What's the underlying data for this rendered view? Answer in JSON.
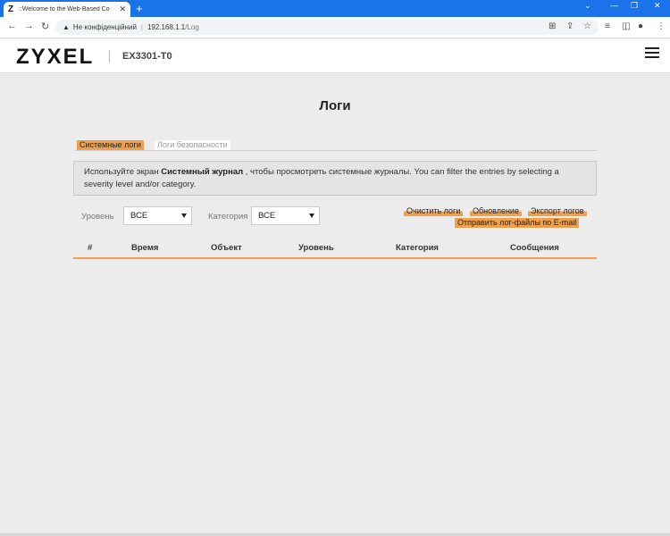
{
  "browser": {
    "tab_title": "::Welcome to the Web-Based Co",
    "tab_favicon": "Z",
    "security_label": "Не конфіденційний",
    "url": "192.168.1.1",
    "url_path": "/Log"
  },
  "header": {
    "logo": "ZYXEL",
    "model": "EX3301-T0"
  },
  "page": {
    "title": "Логи"
  },
  "tabs": {
    "system": "Системные логи",
    "security": "Логи безопасности"
  },
  "info": {
    "part1": "Используйте экран ",
    "bold": "Системный журнал",
    "part2": " , чтобы просмотреть системные журналы. You can filter the entries by selecting a severity level and/or category."
  },
  "filters": {
    "level_label": "Уровень",
    "level_value": "ВСЕ",
    "category_label": "Категория",
    "category_value": "ВСЕ"
  },
  "actions": {
    "clear": "Очистить логи",
    "refresh": "Обновление",
    "export": "Экспорт логов",
    "email": "Отправить лог-файлы по E-mail"
  },
  "table": {
    "columns": [
      "#",
      "Время",
      "Объект",
      "Уровень",
      "Категория",
      "Сообщения"
    ]
  },
  "colors": {
    "accent": "#f0a04b",
    "chrome": "#1a73e8"
  }
}
